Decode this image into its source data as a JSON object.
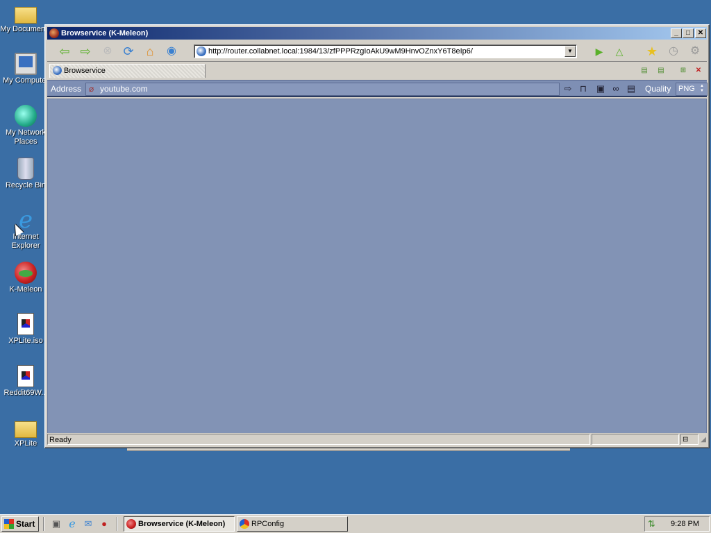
{
  "desktop": {
    "icons": [
      {
        "label": "My Documents",
        "icon": "folder-documents-icon"
      },
      {
        "label": "My Computer",
        "icon": "computer-icon"
      },
      {
        "label": "My Network",
        "label2": "Places",
        "icon": "network-places-icon"
      },
      {
        "label": "Recycle Bin",
        "icon": "recycle-bin-icon"
      },
      {
        "label": "Internet",
        "label2": "Explorer",
        "icon": "internet-explorer-icon"
      },
      {
        "label": "K-Meleon",
        "icon": "k-meleon-icon"
      },
      {
        "label": "XPLite.iso",
        "icon": "iso-file-icon"
      },
      {
        "label": "Reddit69W...",
        "icon": "iso-file-icon"
      },
      {
        "label": "XPLite",
        "icon": "folder-icon"
      }
    ]
  },
  "window": {
    "title": "Browservice (K-Meleon)",
    "caption_buttons": {
      "minimize": "_",
      "maximize": "□",
      "close": "✕"
    },
    "url": "http://router.collabnet.local:1984/13/zfPPPRzgIoAkU9wM9HnvOZnxY6T8eIp6/",
    "tab": {
      "label": "Browservice"
    },
    "address_bar": {
      "label": "Address",
      "value": "youtube.com",
      "quality_label": "Quality",
      "quality_value": "PNG"
    },
    "status": {
      "text": "Ready"
    }
  },
  "taskbar": {
    "start_label": "Start",
    "tasks": [
      {
        "label": "Browservice (K-Meleon)",
        "active": true
      },
      {
        "label": "RPConfig",
        "active": false
      }
    ],
    "clock": "9:28 PM"
  },
  "colors": {
    "desktop_bg": "#3a6ea5",
    "titlebar_start": "#0a246a",
    "titlebar_end": "#a6caf0",
    "content_bg": "#8293b5"
  }
}
